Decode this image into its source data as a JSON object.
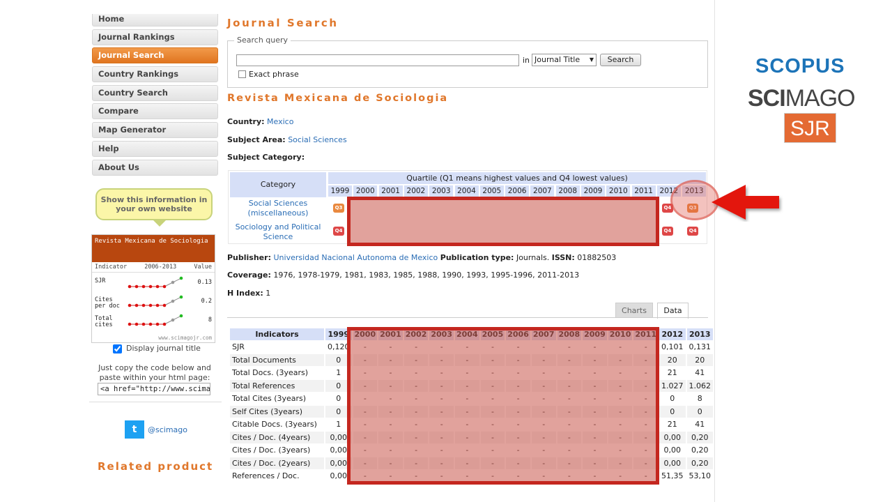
{
  "sidebar": {
    "menu": [
      {
        "label": "Home",
        "active": false
      },
      {
        "label": "Journal Rankings",
        "active": false
      },
      {
        "label": "Journal Search",
        "active": true
      },
      {
        "label": "Country Rankings",
        "active": false
      },
      {
        "label": "Country Search",
        "active": false
      },
      {
        "label": "Compare",
        "active": false
      },
      {
        "label": "Map Generator",
        "active": false
      },
      {
        "label": "Help",
        "active": false
      },
      {
        "label": "About Us",
        "active": false
      }
    ],
    "bubble_text": "Show this information in your own website",
    "widget": {
      "title": "Revista Mexicana de Sociologia",
      "head_indicator": "Indicator",
      "head_years": "2006-2013",
      "head_value": "Value",
      "rows": [
        {
          "label": "SJR",
          "value": "0.13"
        },
        {
          "label": "Cites per doc",
          "value": "0.2"
        },
        {
          "label": "Total cites",
          "value": "8"
        }
      ],
      "footer": "www.scimagojr.com"
    },
    "display_title_label": "Display journal title",
    "copy_text": "Just copy the code below and paste within your html page:",
    "code_value": "<a href=\"http://www.scimagojr",
    "twitter_handle": "@scimago",
    "related": "Related product"
  },
  "main": {
    "page_title": "Journal Search",
    "search": {
      "legend": "Search query",
      "input_value": "",
      "in_label": "in",
      "select_value": "Journal Title",
      "button_label": "Search",
      "exact_label": "Exact phrase"
    },
    "journal_title": "Revista Mexicana de Sociologia",
    "country_label": "Country:",
    "country_value": "Mexico",
    "subject_area_label": "Subject Area:",
    "subject_area_value": "Social Sciences",
    "subject_category_label": "Subject Category:",
    "quartile_table": {
      "category_header": "Category",
      "quartile_header": "Quartile (Q1 means highest values and Q4 lowest values)",
      "years": [
        "1999",
        "2000",
        "2001",
        "2002",
        "2003",
        "2004",
        "2005",
        "2006",
        "2007",
        "2008",
        "2009",
        "2010",
        "2011",
        "2012",
        "2013"
      ],
      "categories": [
        {
          "name": "Social Sciences (miscellaneous)",
          "q1999": "Q3",
          "q2012": "Q4",
          "q2013": "Q3"
        },
        {
          "name": "Sociology and Political Science",
          "q1999": "Q4",
          "q2012": "Q4",
          "q2013": "Q4"
        }
      ]
    },
    "publisher_label": "Publisher:",
    "publisher_value": "Universidad Nacional Autonoma de Mexico",
    "pubtype_label": "Publication type:",
    "pubtype_value": "Journals.",
    "issn_label": "ISSN:",
    "issn_value": "01882503",
    "coverage_label": "Coverage:",
    "coverage_value": "1976, 1978-1979, 1981, 1983, 1985, 1988, 1990, 1993, 1995-1996, 2011-2013",
    "hindex_label": "H Index:",
    "hindex_value": "1",
    "tabs": [
      "Charts",
      "Data"
    ],
    "data_table": {
      "header": "Indicators",
      "years": [
        "1999",
        "2000",
        "2001",
        "2002",
        "2003",
        "2004",
        "2005",
        "2006",
        "2007",
        "2008",
        "2009",
        "2010",
        "2011",
        "2012",
        "2013"
      ],
      "rows": [
        {
          "label": "SJR",
          "v1999": "0,120",
          "v2012": "0,101",
          "v2013": "0,131"
        },
        {
          "label": "Total Documents",
          "v1999": "0",
          "v2012": "20",
          "v2013": "20"
        },
        {
          "label": "Total Docs. (3years)",
          "v1999": "1",
          "v2012": "21",
          "v2013": "41"
        },
        {
          "label": "Total References",
          "v1999": "0",
          "v2012": "1.027",
          "v2013": "1.062"
        },
        {
          "label": "Total Cites (3years)",
          "v1999": "0",
          "v2012": "0",
          "v2013": "8"
        },
        {
          "label": "Self Cites (3years)",
          "v1999": "0",
          "v2012": "0",
          "v2013": "0"
        },
        {
          "label": "Citable Docs. (3years)",
          "v1999": "1",
          "v2012": "21",
          "v2013": "41"
        },
        {
          "label": "Cites / Doc. (4years)",
          "v1999": "0,00",
          "v2012": "0,00",
          "v2013": "0,20"
        },
        {
          "label": "Cites / Doc. (3years)",
          "v1999": "0,00",
          "v2012": "0,00",
          "v2013": "0,20"
        },
        {
          "label": "Cites / Doc. (2years)",
          "v1999": "0,00",
          "v2012": "0,00",
          "v2013": "0,20"
        },
        {
          "label": "References / Doc.",
          "v1999": "0,00",
          "v2012": "51,35",
          "v2013": "53,10"
        }
      ],
      "empty_cell": "-"
    }
  },
  "logos": {
    "scopus": "SCOPUS",
    "scimago_bold": "SCI",
    "scimago_rest": "MAGO",
    "sjr": "SJR"
  },
  "colors": {
    "accent": "#e0772b",
    "link": "#2a6db5",
    "highlight_red": "#c4271f",
    "q3": "#e9893f",
    "q4": "#de4747"
  }
}
